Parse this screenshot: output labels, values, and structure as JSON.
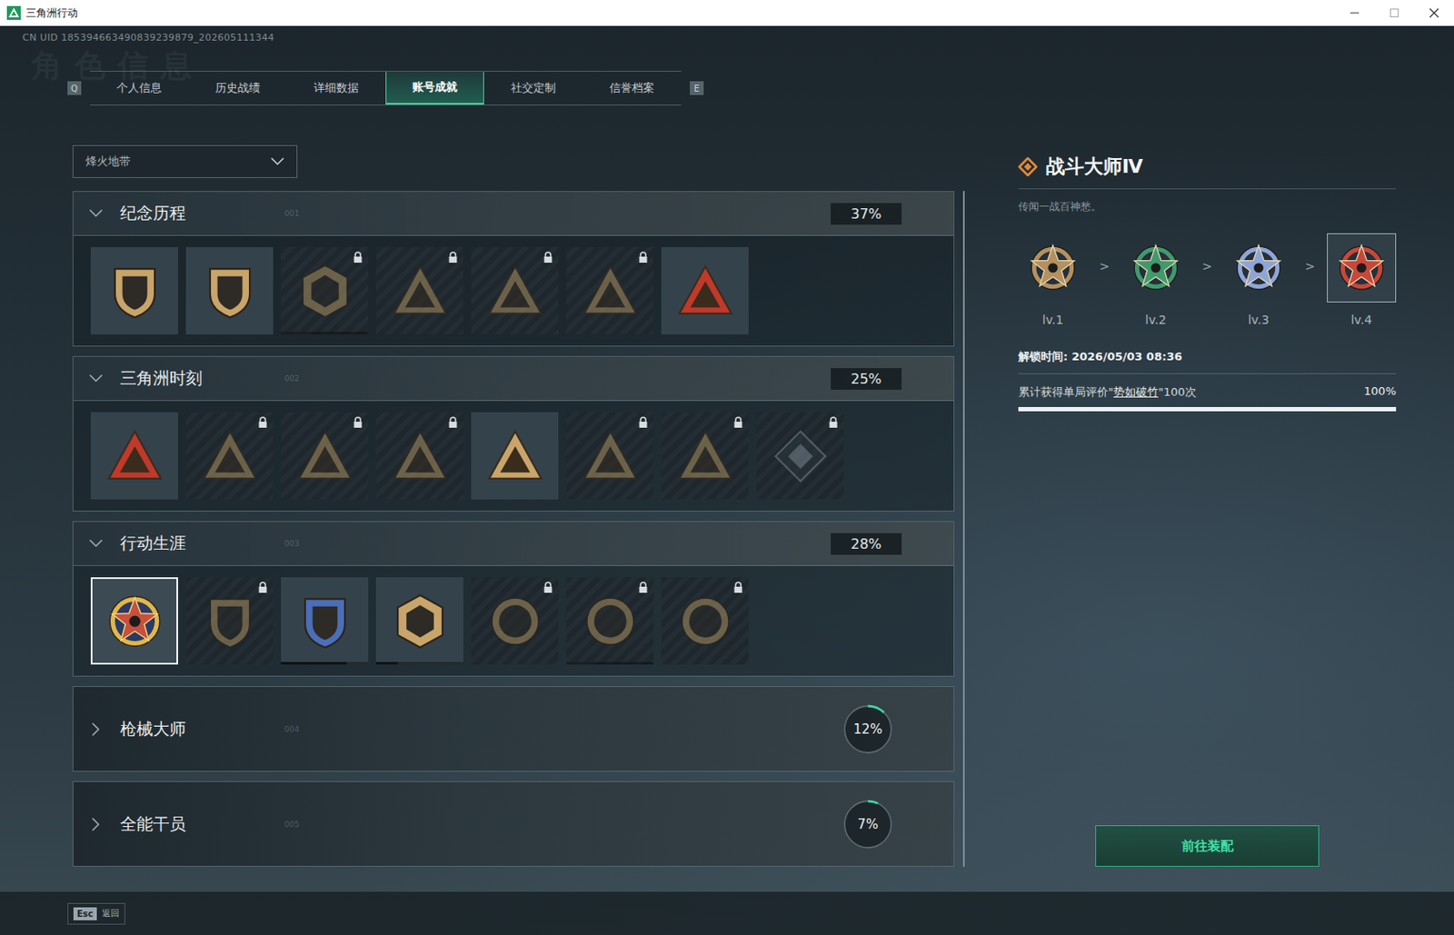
{
  "window": {
    "title": "三角洲行动"
  },
  "uid": "CN UID 185394663490839239879_202605111344",
  "watermark": "角色信息",
  "tabs": {
    "prev_key": "Q",
    "next_key": "E",
    "items": [
      {
        "label": "个人信息",
        "selected": false
      },
      {
        "label": "历史战绩",
        "selected": false
      },
      {
        "label": "详细数据",
        "selected": false
      },
      {
        "label": "账号成就",
        "selected": true
      },
      {
        "label": "社交定制",
        "selected": false
      },
      {
        "label": "信誉档案",
        "selected": false
      }
    ]
  },
  "filter": {
    "value": "烽火地带"
  },
  "sections": [
    {
      "title": "纪念历程",
      "code": "001",
      "percent": "37%",
      "expanded": true,
      "badges": [
        {
          "shape": "shield",
          "color": "#c8a56a",
          "locked": false,
          "selected": false
        },
        {
          "shape": "shield",
          "color": "#c8a56a",
          "locked": false,
          "selected": false
        },
        {
          "shape": "hex",
          "color": "#c8a56a",
          "locked": true,
          "selected": false,
          "progress": 0.35
        },
        {
          "shape": "triangle",
          "color": "#c8a56a",
          "locked": true,
          "selected": false
        },
        {
          "shape": "triangle",
          "color": "#c8a56a",
          "locked": true,
          "selected": false
        },
        {
          "shape": "triangle",
          "color": "#c8a56a",
          "locked": true,
          "selected": false
        },
        {
          "shape": "triangle",
          "color": "#c0392b",
          "locked": false,
          "selected": false
        }
      ]
    },
    {
      "title": "三角洲时刻",
      "code": "002",
      "percent": "25%",
      "expanded": true,
      "badges": [
        {
          "shape": "triangle",
          "color": "#c0392b",
          "locked": false,
          "selected": false
        },
        {
          "shape": "triangle",
          "color": "#c8a56a",
          "locked": true,
          "selected": false
        },
        {
          "shape": "triangle",
          "color": "#c8a56a",
          "locked": true,
          "selected": false
        },
        {
          "shape": "triangle",
          "color": "#c8a56a",
          "locked": true,
          "selected": false
        },
        {
          "shape": "triangle",
          "color": "#c8a56a",
          "locked": false,
          "selected": false
        },
        {
          "shape": "triangle",
          "color": "#c8a56a",
          "locked": true,
          "selected": false
        },
        {
          "shape": "triangle",
          "color": "#c8a56a",
          "locked": true,
          "selected": false
        },
        {
          "shape": "diamond",
          "color": "#8a9aa6",
          "locked": true,
          "selected": false
        }
      ]
    },
    {
      "title": "行动生涯",
      "code": "003",
      "percent": "28%",
      "expanded": true,
      "badges": [
        {
          "shape": "star",
          "color": "#c7503f",
          "locked": false,
          "selected": true
        },
        {
          "shape": "shield",
          "color": "#c8a56a",
          "locked": true,
          "selected": false
        },
        {
          "shape": "shield",
          "color": "#4a6fb8",
          "locked": false,
          "selected": false,
          "progress": 0.75
        },
        {
          "shape": "hex",
          "color": "#c8a56a",
          "locked": false,
          "selected": false,
          "progress": 0.25
        },
        {
          "shape": "round",
          "color": "#c8a56a",
          "locked": true,
          "selected": false
        },
        {
          "shape": "round",
          "color": "#c8a56a",
          "locked": true,
          "selected": false,
          "progress": 0.3
        },
        {
          "shape": "round",
          "color": "#c8a56a",
          "locked": true,
          "selected": false
        }
      ]
    },
    {
      "title": "枪械大师",
      "code": "004",
      "percent": "12%",
      "expanded": false,
      "level": 0.12,
      "badges": []
    },
    {
      "title": "全能干员",
      "code": "005",
      "percent": "7%",
      "expanded": false,
      "level": 0.07,
      "badges": []
    }
  ],
  "detail": {
    "title": "战斗大师Ⅳ",
    "description": "传闻一战百神愁。",
    "separator": ">",
    "tiers": [
      {
        "label": "lv.1",
        "color": "#b4915f",
        "selected": false
      },
      {
        "label": "lv.2",
        "color": "#3f9a6e",
        "selected": false
      },
      {
        "label": "lv.3",
        "color": "#8fa5d8",
        "selected": false
      },
      {
        "label": "lv.4",
        "color": "#c9473a",
        "selected": true
      }
    ],
    "unlock": "解锁时间: 2026/05/03 08:36",
    "task": {
      "before": "累计获得单局评价\"",
      "highlight": "势如破竹",
      "after": "\"100次",
      "percent": "100%",
      "level": 1
    },
    "button": "前往装配"
  },
  "footer": {
    "key": "Esc",
    "label": "返回"
  }
}
